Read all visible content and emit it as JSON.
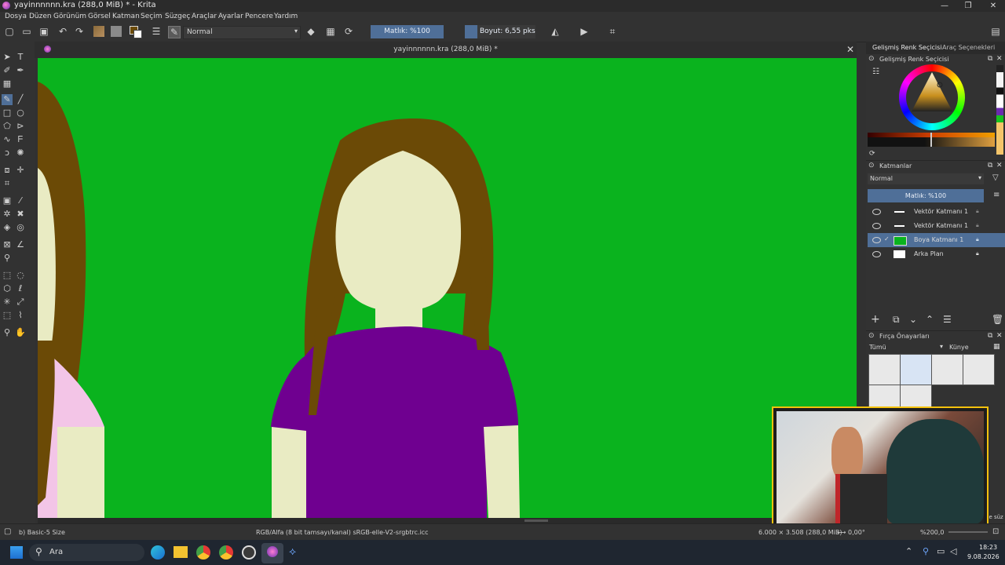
{
  "window": {
    "title": "yayinnnnnn.kra (288,0 MiB) * - Krita"
  },
  "menu": [
    "Dosya",
    "Düzen",
    "Görünüm",
    "Görsel",
    "Katman",
    "Seçim",
    "Süzgeç",
    "Araçlar",
    "Ayarlar",
    "Pencere",
    "Yardım"
  ],
  "toolbar": {
    "blend_mode": "Normal",
    "opacity": "Matlık: %100",
    "size": "Boyut: 6,55 pks"
  },
  "document": {
    "tab_title": "yayinnnnnn.kra (288,0 MiB) *"
  },
  "right_tabs": [
    "Gelişmiş Renk Seçicisi",
    "Araç Seçenekleri"
  ],
  "color_selector": {
    "title": "Gelişmiş Renk Seçicisi"
  },
  "layers": {
    "title": "Katmanlar",
    "blend_mode": "Normal",
    "opacity": "Matlık: %100",
    "items": [
      {
        "name": "Vektör Katmanı 1",
        "selected": false
      },
      {
        "name": "Vektör Katmanı 1",
        "selected": false
      },
      {
        "name": "Boya Katmanı 1",
        "selected": true
      },
      {
        "name": "Arka Plan",
        "selected": false
      }
    ]
  },
  "brush_presets": {
    "title": "Fırça Önayarları",
    "filter": "Tümü",
    "tag": "Künye",
    "search_hint": "de süz"
  },
  "status": {
    "brush": "b) Basic-5 Size",
    "color_space": "RGB/Alfa (8 bit tamsayı/kanal) sRGB-elle-V2-srgbtrc.icc",
    "dimensions": "6.000 × 3.508 (288,0 MiB)",
    "rotation": "0,00°",
    "zoom": "%200,0"
  },
  "taskbar": {
    "search_placeholder": "Ara",
    "time": "18:23",
    "date": "9.08.2026"
  },
  "colors": {
    "canvas_green": "#0ab31e",
    "hair_brown": "#6b4a06",
    "shirt_purple": "#6f0090",
    "skin_cream": "#e9ebc3",
    "accent_blue": "#4f6f98"
  }
}
